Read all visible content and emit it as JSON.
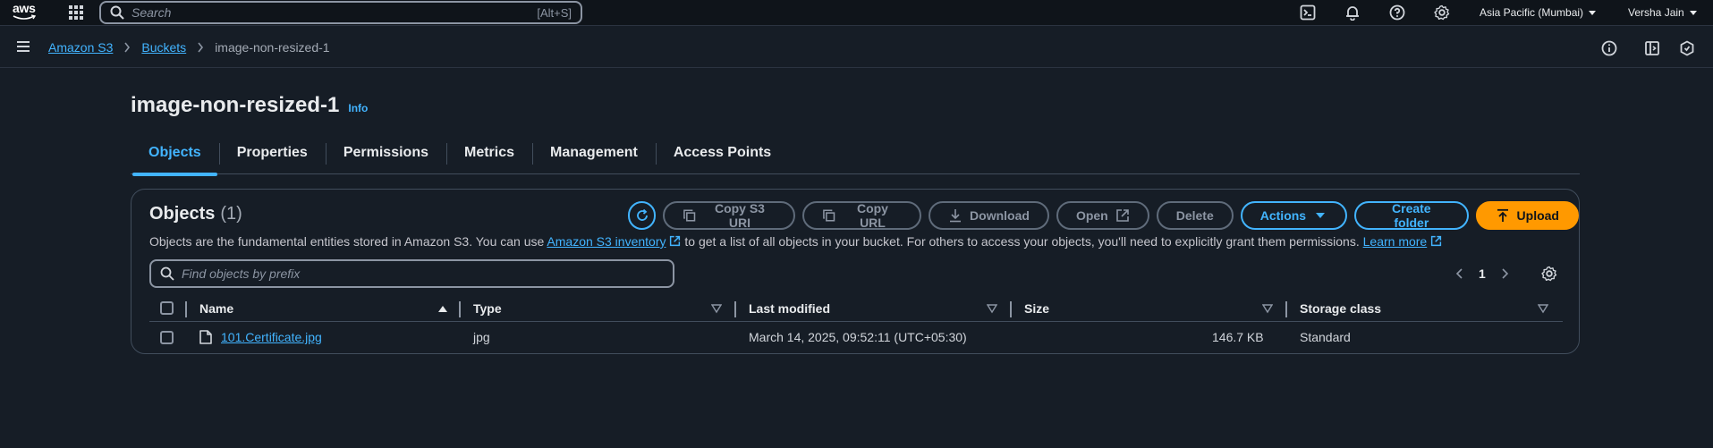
{
  "topnav": {
    "logo_text": "aws",
    "search_placeholder": "Search",
    "search_shortcut": "[Alt+S]",
    "region": "Asia Pacific (Mumbai)",
    "user": "Versha Jain"
  },
  "breadcrumb": {
    "items": [
      "Amazon S3",
      "Buckets"
    ],
    "current": "image-non-resized-1"
  },
  "page": {
    "title": "image-non-resized-1",
    "info_label": "Info"
  },
  "tabs": [
    "Objects",
    "Properties",
    "Permissions",
    "Metrics",
    "Management",
    "Access Points"
  ],
  "objects_panel": {
    "heading": "Objects",
    "count": "(1)",
    "description_pre": "Objects are the fundamental entities stored in Amazon S3. You can use",
    "inventory_link": "Amazon S3 inventory",
    "description_mid": "to get a list of all objects in your bucket. For others to access your objects, you'll need to explicitly grant them permissions.",
    "learn_more": "Learn more",
    "buttons": {
      "copy_s3_uri": "Copy S3 URI",
      "copy_url": "Copy URL",
      "download": "Download",
      "open": "Open",
      "delete": "Delete",
      "actions": "Actions",
      "create_folder": "Create folder",
      "upload": "Upload"
    },
    "filter_placeholder": "Find objects by prefix",
    "page_number": "1"
  },
  "table": {
    "columns": [
      "Name",
      "Type",
      "Last modified",
      "Size",
      "Storage class"
    ],
    "rows": [
      {
        "name": "101.Certificate.jpg",
        "type": "jpg",
        "last_modified": "March 14, 2025, 09:52:11 (UTC+05:30)",
        "size": "146.7 KB",
        "storage_class": "Standard"
      }
    ]
  },
  "colors": {
    "background": "#161d26",
    "topnav": "#0f141a",
    "link": "#42b4ff",
    "primary": "#ff9900",
    "text": "#e9ebed"
  }
}
